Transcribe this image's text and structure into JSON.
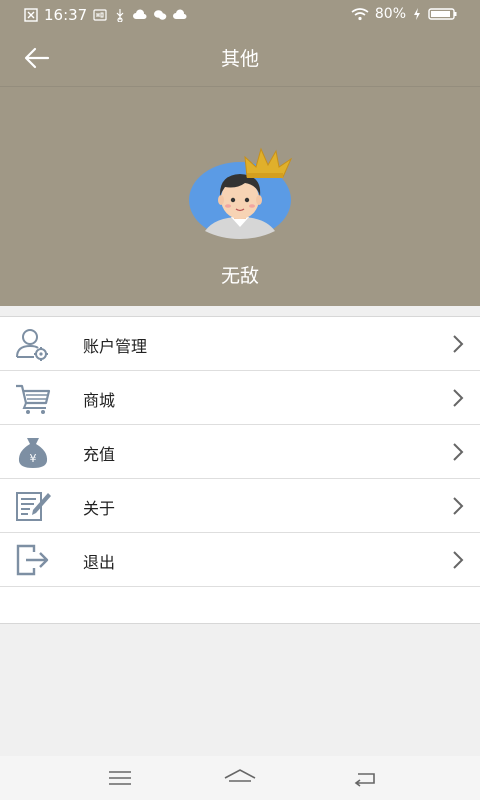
{
  "status_bar": {
    "time": "16:37",
    "battery": "80%",
    "icons": [
      "close-box-icon",
      "hd-icon",
      "usb-icon",
      "cloud-icon",
      "wechat-icon",
      "cloud-icon",
      "wifi-icon",
      "charging-icon",
      "battery-icon"
    ]
  },
  "header": {
    "title": "其他",
    "back_icon": "back-arrow-icon"
  },
  "profile": {
    "username": "无敌",
    "avatar_icon": "avatar-with-crown"
  },
  "menu": {
    "items": [
      {
        "label": "账户管理",
        "icon": "user-settings-icon"
      },
      {
        "label": "商城",
        "icon": "shopping-cart-icon"
      },
      {
        "label": "充值",
        "icon": "money-bag-icon"
      },
      {
        "label": "关于",
        "icon": "edit-note-icon"
      },
      {
        "label": "退出",
        "icon": "logout-icon"
      }
    ]
  },
  "nav": {
    "buttons": [
      "menu-icon",
      "home-icon",
      "back-icon"
    ]
  },
  "colors": {
    "header_bg": "#a09886",
    "page_bg": "#f0f0f0",
    "menu_bg": "#ffffff",
    "icon_color": "#7d8fa3"
  }
}
